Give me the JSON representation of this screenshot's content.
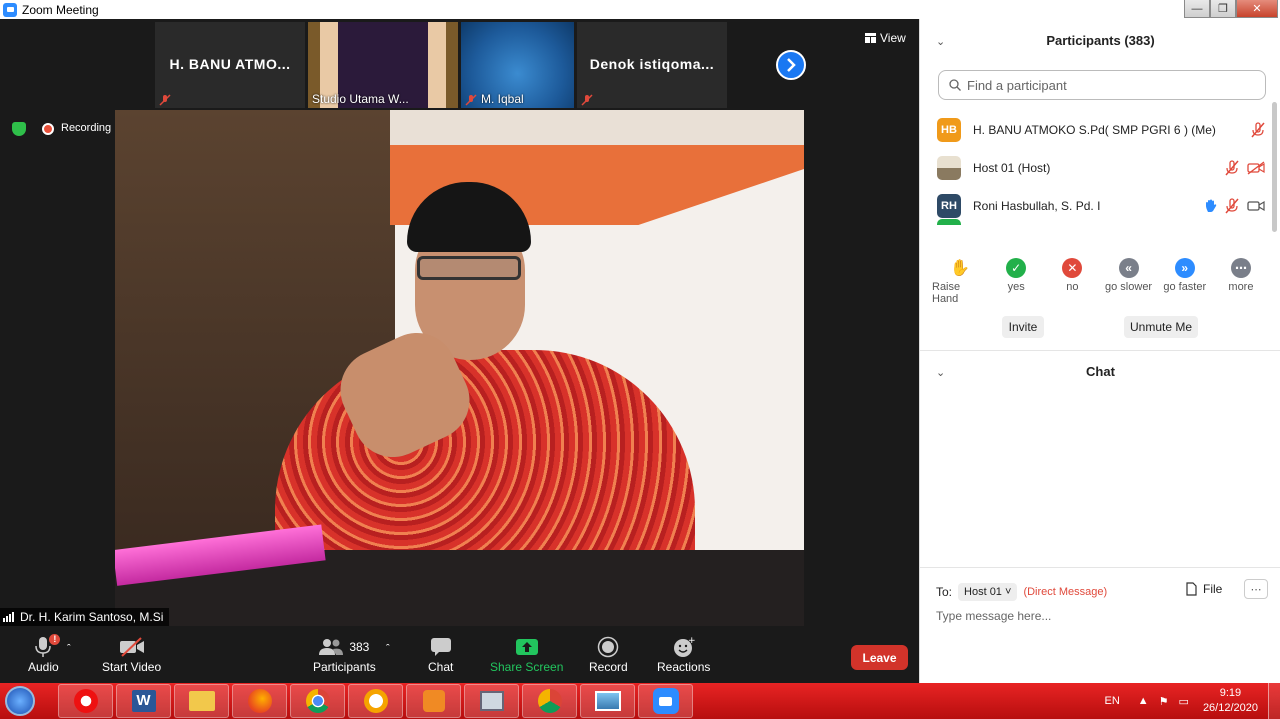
{
  "window": {
    "title": "Zoom Meeting"
  },
  "gallery": {
    "tiles": [
      {
        "name": "H. BANU ATMO..."
      },
      {
        "label": "Studio Utama W..."
      },
      {
        "label": "M. Iqbal"
      },
      {
        "name": "Denok  istiqoma..."
      }
    ],
    "view_label": "View"
  },
  "status": {
    "recording_label": "Recording"
  },
  "active_speaker": {
    "name": "Dr. H. Karim Santoso, M.Si"
  },
  "toolbar": {
    "audio_label": "Audio",
    "start_video_label": "Start Video",
    "participants_label": "Participants",
    "participants_count": "383",
    "chat_label": "Chat",
    "share_screen_label": "Share Screen",
    "record_label": "Record",
    "reactions_label": "Reactions",
    "leave_label": "Leave"
  },
  "participants_panel": {
    "title": "Participants (383)",
    "search_placeholder": "Find a participant",
    "rows": [
      {
        "initials": "HB",
        "avatar_color": "#f09a1a",
        "name": "H. BANU ATMOKO     S.Pd( SMP PGRI 6 ) (Me)"
      },
      {
        "initials": "",
        "avatar_color": "#c8c0b0",
        "name": "Host 01 (Host)"
      },
      {
        "initials": "RH",
        "avatar_color": "#2e4a66",
        "name": "Roni Hasbullah, S. Pd. I"
      }
    ],
    "reactions": [
      {
        "label": "Raise Hand",
        "icon": "raise-hand-icon",
        "color": "#2d8cff"
      },
      {
        "label": "yes",
        "icon": "check-icon",
        "color": "#22b04a"
      },
      {
        "label": "no",
        "icon": "x-icon",
        "color": "#e0493b"
      },
      {
        "label": "go slower",
        "icon": "rewind-icon",
        "color": "#7a7f8a"
      },
      {
        "label": "go faster",
        "icon": "fast-forward-icon",
        "color": "#2d8cff"
      },
      {
        "label": "more",
        "icon": "ellipsis-icon",
        "color": "#7a7f8a"
      }
    ],
    "invite_label": "Invite",
    "unmute_me_label": "Unmute Me"
  },
  "chat_panel": {
    "title": "Chat",
    "to_label": "To:",
    "recipient": "Host 01",
    "direct_message_label": "(Direct Message)",
    "file_label": "File",
    "input_placeholder": "Type message here..."
  },
  "taskbar": {
    "language": "EN",
    "time": "9:19",
    "date": "26/12/2020"
  }
}
